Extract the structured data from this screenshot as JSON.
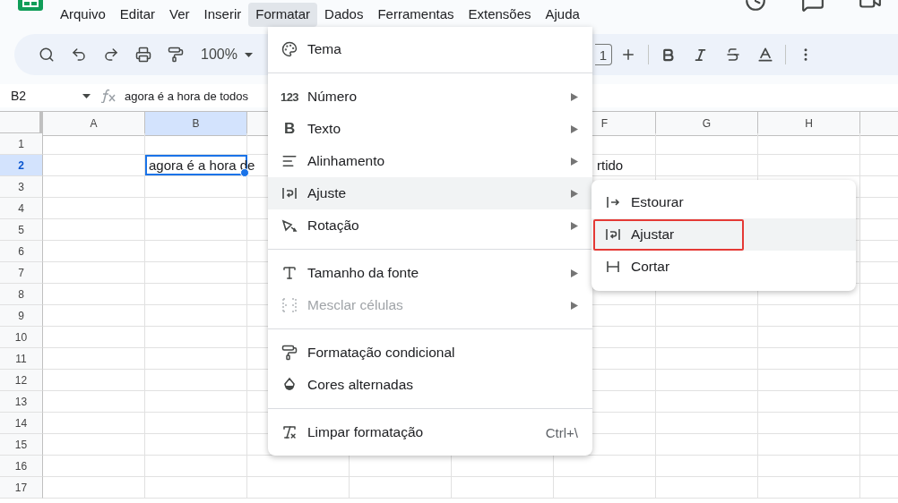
{
  "menubar": [
    {
      "label": "Arquivo",
      "selected": false
    },
    {
      "label": "Editar",
      "selected": false
    },
    {
      "label": "Ver",
      "selected": false
    },
    {
      "label": "Inserir",
      "selected": false
    },
    {
      "label": "Formatar",
      "selected": true
    },
    {
      "label": "Dados",
      "selected": false
    },
    {
      "label": "Ferramentas",
      "selected": false
    },
    {
      "label": "Extensões",
      "selected": false
    },
    {
      "label": "Ajuda",
      "selected": false
    }
  ],
  "toolbar": {
    "zoom": "100%",
    "font_size": "1"
  },
  "name_box": "B2",
  "formula": "agora é a hora de todos",
  "columns": [
    {
      "label": "A",
      "selected": false
    },
    {
      "label": "B",
      "selected": true
    },
    {
      "label": "F",
      "selected": false
    },
    {
      "label": "G",
      "selected": false
    },
    {
      "label": "H",
      "selected": false
    }
  ],
  "rows": [
    {
      "label": "1",
      "selected": false
    },
    {
      "label": "2",
      "selected": true,
      "cells": [
        {
          "text": "agora é a hora de",
          "active": true
        },
        {
          "text": "rtido",
          "active": false
        }
      ]
    },
    {
      "label": "3",
      "selected": false
    },
    {
      "label": "4",
      "selected": false
    },
    {
      "label": "5",
      "selected": false
    },
    {
      "label": "6",
      "selected": false
    },
    {
      "label": "7",
      "selected": false
    },
    {
      "label": "8",
      "selected": false
    },
    {
      "label": "9",
      "selected": false
    },
    {
      "label": "10",
      "selected": false
    },
    {
      "label": "11",
      "selected": false
    },
    {
      "label": "12",
      "selected": false
    },
    {
      "label": "13",
      "selected": false
    },
    {
      "label": "14",
      "selected": false
    },
    {
      "label": "15",
      "selected": false
    },
    {
      "label": "16",
      "selected": false
    },
    {
      "label": "17",
      "selected": false
    }
  ],
  "format_menu": [
    {
      "kind": "item",
      "label": "Tema",
      "submenu": false,
      "disabled": false,
      "selected": false
    },
    {
      "kind": "divider"
    },
    {
      "kind": "item",
      "glyph": "123",
      "label": "Número",
      "submenu": true,
      "disabled": false,
      "selected": false
    },
    {
      "kind": "item",
      "glyph": "B",
      "label": "Texto",
      "submenu": true,
      "disabled": false,
      "selected": false
    },
    {
      "kind": "item",
      "label": "Alinhamento",
      "submenu": true,
      "disabled": false,
      "selected": false
    },
    {
      "kind": "item",
      "label": "Ajuste",
      "submenu": true,
      "disabled": false,
      "selected": true
    },
    {
      "kind": "item",
      "label": "Rotação",
      "submenu": true,
      "disabled": false,
      "selected": false
    },
    {
      "kind": "divider"
    },
    {
      "kind": "item",
      "label": "Tamanho da fonte",
      "submenu": true,
      "disabled": false,
      "selected": false
    },
    {
      "kind": "item",
      "label": "Mesclar células",
      "submenu": true,
      "disabled": true,
      "selected": false
    },
    {
      "kind": "divider"
    },
    {
      "kind": "item",
      "label": "Formatação condicional",
      "submenu": false,
      "disabled": false,
      "selected": false
    },
    {
      "kind": "item",
      "label": "Cores alternadas",
      "submenu": false,
      "disabled": false,
      "selected": false
    },
    {
      "kind": "divider"
    },
    {
      "kind": "item",
      "label": "Limpar formatação",
      "shortcut": "Ctrl+\\",
      "submenu": false,
      "disabled": false,
      "selected": false
    }
  ],
  "wrap_submenu": [
    {
      "label": "Estourar",
      "selected": false,
      "annotated": false
    },
    {
      "label": "Ajustar",
      "selected": true,
      "annotated": true
    },
    {
      "label": "Cortar",
      "selected": false,
      "annotated": false
    }
  ]
}
